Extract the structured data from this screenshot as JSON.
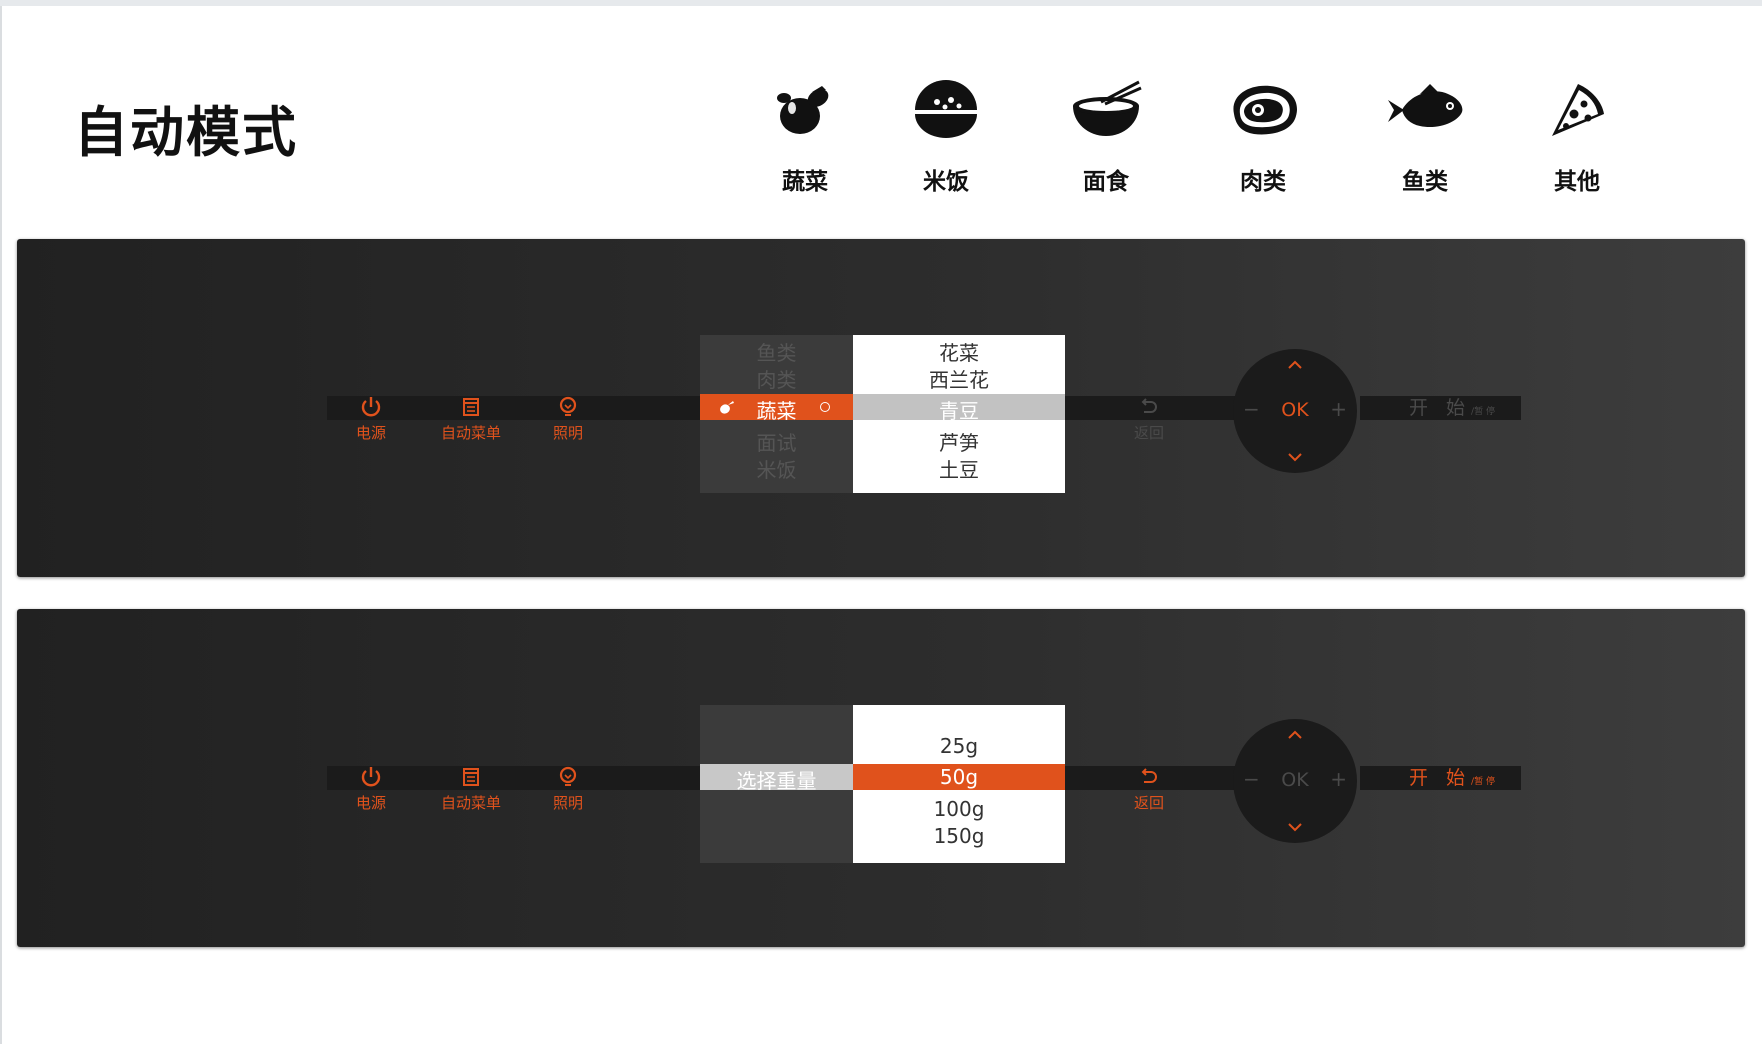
{
  "page": {
    "title": "自动模式"
  },
  "categories": [
    {
      "label": "蔬菜",
      "icon": "eggplant-icon"
    },
    {
      "label": "米饭",
      "icon": "rice-bowl-icon"
    },
    {
      "label": "面食",
      "icon": "noodle-bowl-icon"
    },
    {
      "label": "肉类",
      "icon": "steak-icon"
    },
    {
      "label": "鱼类",
      "icon": "fish-icon"
    },
    {
      "label": "其他",
      "icon": "pizza-slice-icon"
    }
  ],
  "colors": {
    "accent": "#e0521c",
    "panel": "#2a2a2a",
    "dim": "#4a4a4a"
  },
  "panel1": {
    "controls": {
      "power": "电源",
      "auto_menu": "自动菜单",
      "light": "照明",
      "back": "返回"
    },
    "left_list": {
      "above": [
        "鱼类",
        "肉类"
      ],
      "selected": "蔬菜",
      "below": [
        "面试",
        "米饭"
      ]
    },
    "right_list": {
      "above": [
        "花菜",
        "西兰花"
      ],
      "selected": "青豆",
      "below": [
        "芦笋",
        "土豆"
      ]
    },
    "dial": {
      "ok": "OK",
      "minus": "−",
      "plus": "+"
    },
    "start": {
      "main": "开 始",
      "sub": "/暂 停"
    }
  },
  "panel2": {
    "controls": {
      "power": "电源",
      "auto_menu": "自动菜单",
      "light": "照明",
      "back": "返回"
    },
    "left_list": {
      "selected": "选择重量"
    },
    "right_list": {
      "above": [
        "25g"
      ],
      "selected": "50g",
      "below": [
        "100g",
        "150g"
      ]
    },
    "dial": {
      "ok": "OK",
      "minus": "−",
      "plus": "+"
    },
    "start": {
      "main": "开 始",
      "sub": "/暂 停"
    }
  }
}
